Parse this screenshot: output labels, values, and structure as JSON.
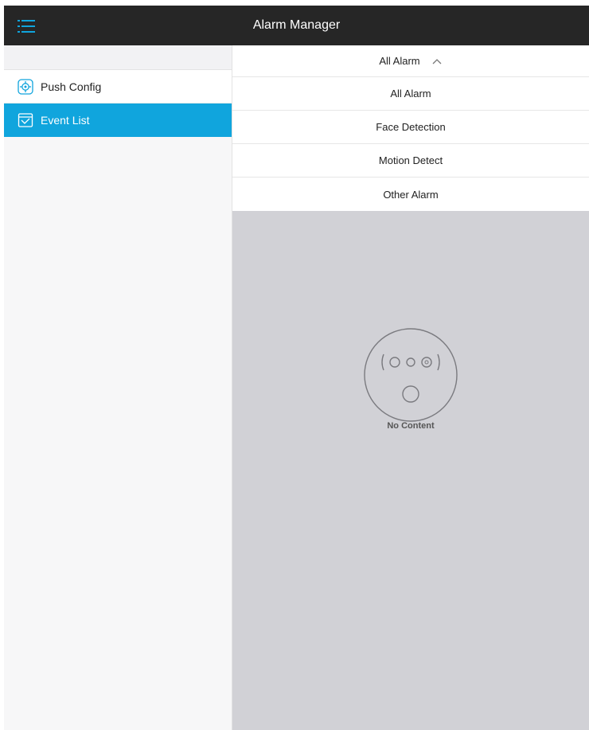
{
  "header": {
    "title": "Alarm Manager",
    "menu_icon": "menu-icon"
  },
  "sidebar": {
    "items": [
      {
        "label": "Push Config",
        "icon": "gear-icon",
        "active": false
      },
      {
        "label": "Event List",
        "icon": "event-list-icon",
        "active": true
      }
    ]
  },
  "filter": {
    "selected": "All Alarm",
    "options": [
      "All Alarm",
      "Face Detection",
      "Motion Detect",
      "Other Alarm"
    ]
  },
  "empty_state": {
    "label": "No Content",
    "icon": "no-content-icon"
  },
  "colors": {
    "topbar": "#262626",
    "accent": "#10a5dd",
    "content_bg": "#d1d1d6"
  }
}
